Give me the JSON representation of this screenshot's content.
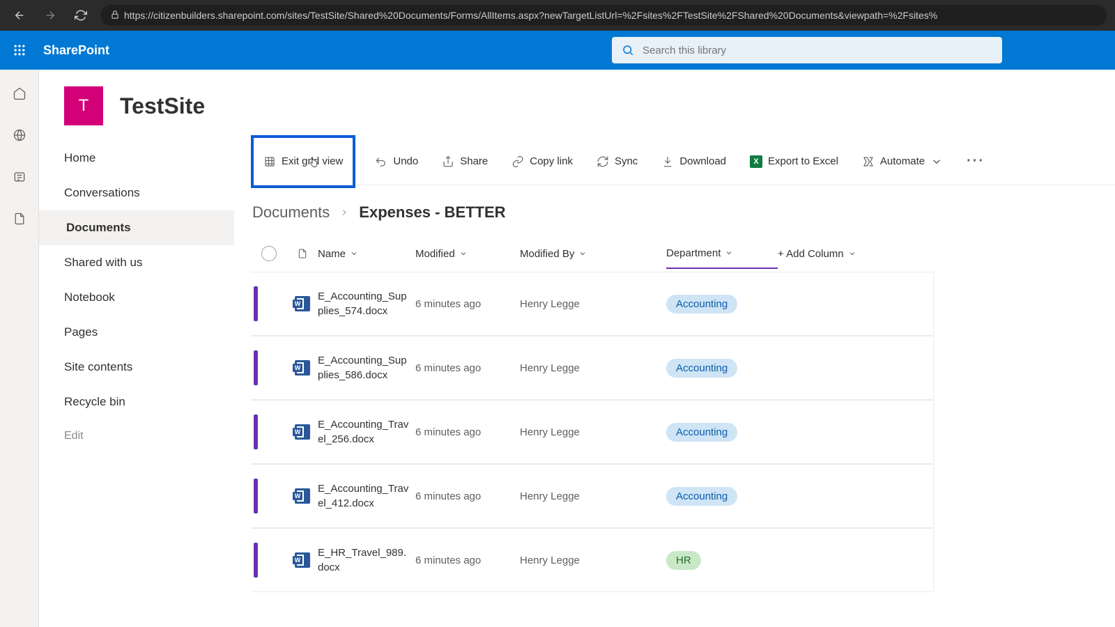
{
  "browser": {
    "url": "https://citizenbuilders.sharepoint.com/sites/TestSite/Shared%20Documents/Forms/AllItems.aspx?newTargetListUrl=%2Fsites%2FTestSite%2FShared%20Documents&viewpath=%2Fsites%"
  },
  "suite": {
    "app_name": "SharePoint",
    "search_placeholder": "Search this library"
  },
  "site": {
    "logo_letter": "T",
    "title": "TestSite"
  },
  "left_nav": {
    "items": [
      {
        "label": "Home",
        "active": false
      },
      {
        "label": "Conversations",
        "active": false
      },
      {
        "label": "Documents",
        "active": true
      },
      {
        "label": "Shared with us",
        "active": false
      },
      {
        "label": "Notebook",
        "active": false
      },
      {
        "label": "Pages",
        "active": false
      },
      {
        "label": "Site contents",
        "active": false
      },
      {
        "label": "Recycle bin",
        "active": false
      }
    ],
    "edit_label": "Edit"
  },
  "toolbar": {
    "exit_grid": "Exit grid view",
    "undo": "Undo",
    "share": "Share",
    "copy_link": "Copy link",
    "sync": "Sync",
    "download": "Download",
    "export_excel": "Export to Excel",
    "automate": "Automate"
  },
  "breadcrumb": {
    "root": "Documents",
    "leaf": "Expenses - BETTER"
  },
  "columns": {
    "name": "Name",
    "modified": "Modified",
    "modified_by": "Modified By",
    "department": "Department",
    "add_column": "+ Add Column"
  },
  "rows": [
    {
      "name": "E_Accounting_Supplies_574.docx",
      "modified": "6 minutes ago",
      "modified_by": "Henry Legge",
      "department": "Accounting",
      "dept_class": "dept-accounting"
    },
    {
      "name": "E_Accounting_Supplies_586.docx",
      "modified": "6 minutes ago",
      "modified_by": "Henry Legge",
      "department": "Accounting",
      "dept_class": "dept-accounting"
    },
    {
      "name": "E_Accounting_Travel_256.docx",
      "modified": "6 minutes ago",
      "modified_by": "Henry Legge",
      "department": "Accounting",
      "dept_class": "dept-accounting"
    },
    {
      "name": "E_Accounting_Travel_412.docx",
      "modified": "6 minutes ago",
      "modified_by": "Henry Legge",
      "department": "Accounting",
      "dept_class": "dept-accounting"
    },
    {
      "name": "E_HR_Travel_989.docx",
      "modified": "6 minutes ago",
      "modified_by": "Henry Legge",
      "department": "HR",
      "dept_class": "dept-hr"
    }
  ]
}
